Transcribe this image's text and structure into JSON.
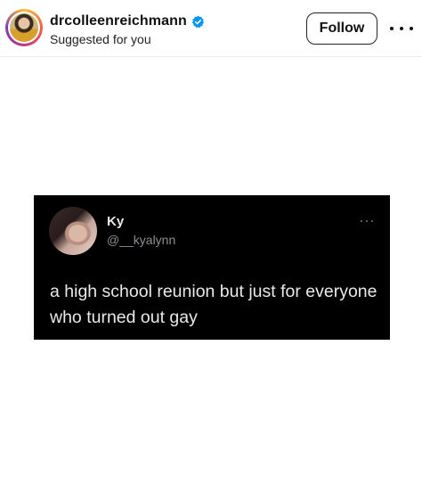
{
  "post_header": {
    "username": "drcolleenreichmann",
    "verified_icon": "verified-badge-icon",
    "subtitle": "Suggested for you",
    "follow_label": "Follow",
    "more_icon": "more-horizontal-icon"
  },
  "tweet": {
    "name": "Ky",
    "handle": "@__kyalynn",
    "text": "a high school reunion but just for everyone who turned out gay",
    "more_icon": "more-horizontal-icon"
  },
  "colors": {
    "follow_border": "#222222",
    "verified_blue": "#0095f6",
    "tweet_background": "#000000",
    "tweet_text": "#e9e9e9",
    "tweet_handle": "#8b8f94"
  }
}
